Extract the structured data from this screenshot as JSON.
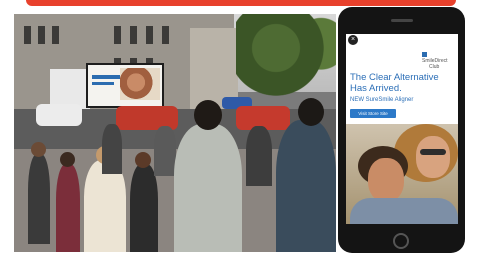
{
  "phone_ad": {
    "close_symbol": "×",
    "brand_line1": "SmileDirect",
    "brand_line2": "Club",
    "headline_line1": "The Clear Alternative",
    "headline_line2": "Has Arrived.",
    "subheadline": "NEW SureSmile Aligner",
    "cta_label": "Visit Store Site"
  },
  "colors": {
    "accent_red": "#e8412c",
    "ad_blue": "#2c6fb7",
    "phone_body": "#141414"
  }
}
